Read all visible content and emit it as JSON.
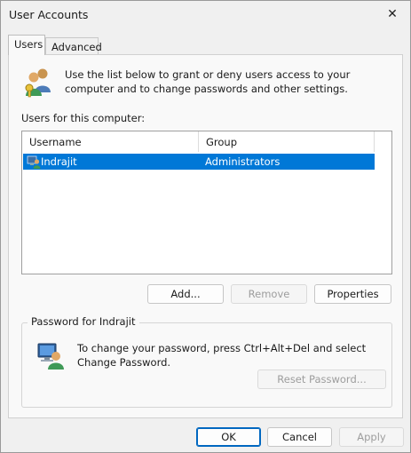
{
  "window": {
    "title": "User Accounts",
    "close_glyph": "✕"
  },
  "tabs": [
    {
      "label": "Users",
      "active": true
    },
    {
      "label": "Advanced",
      "active": false
    }
  ],
  "intro": {
    "text": "Use the list below to grant or deny users access to your computer and to change passwords and other settings.",
    "icon": "users-keys-icon"
  },
  "users_list": {
    "label": "Users for this computer:",
    "columns": [
      "Username",
      "Group"
    ],
    "rows": [
      {
        "username": "Indrajit",
        "group": "Administrators",
        "selected": true,
        "icon": "user-icon"
      }
    ]
  },
  "list_buttons": {
    "add": "Add...",
    "remove": "Remove",
    "properties": "Properties"
  },
  "password_group": {
    "legend": "Password for Indrajit",
    "text": "To change your password, press Ctrl+Alt+Del and select Change Password.",
    "reset_button": "Reset Password...",
    "icon": "user-computer-icon"
  },
  "footer": {
    "ok": "OK",
    "cancel": "Cancel",
    "apply": "Apply"
  },
  "colors": {
    "selection": "#0078d7",
    "default_button_border": "#0067c0"
  }
}
